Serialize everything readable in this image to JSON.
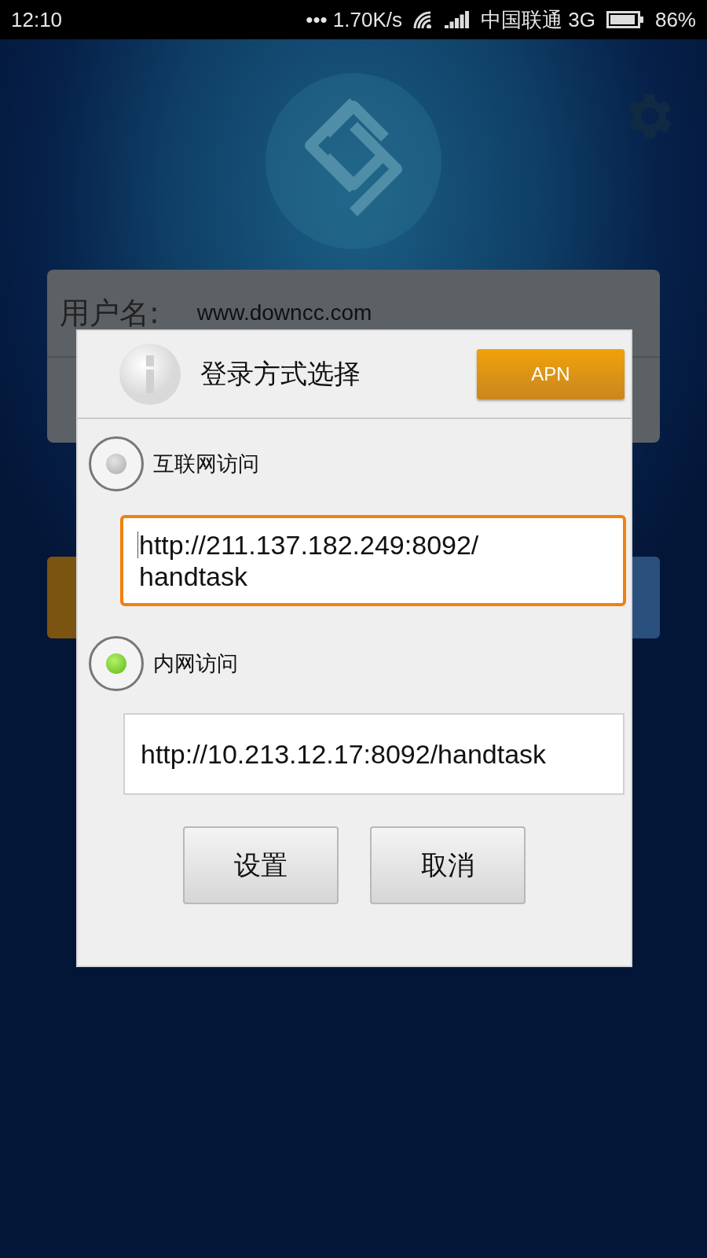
{
  "status_bar": {
    "time": "12:10",
    "speed": "••• 1.70K/s",
    "carrier": "中国联通 3G",
    "battery": "86%"
  },
  "login_form": {
    "username_label": "用户名:",
    "username_value": "www.downcc.com"
  },
  "dialog": {
    "title": "登录方式选择",
    "apn_button": "APN",
    "options": [
      {
        "label": "互联网访问",
        "selected": false,
        "url": "http://211.137.182.249:8092/handtask",
        "focused": true
      },
      {
        "label": "内网访问",
        "selected": true,
        "url": "http://10.213.12.17:8092/handtask",
        "focused": false
      }
    ],
    "buttons": [
      "设置",
      "取消"
    ]
  }
}
